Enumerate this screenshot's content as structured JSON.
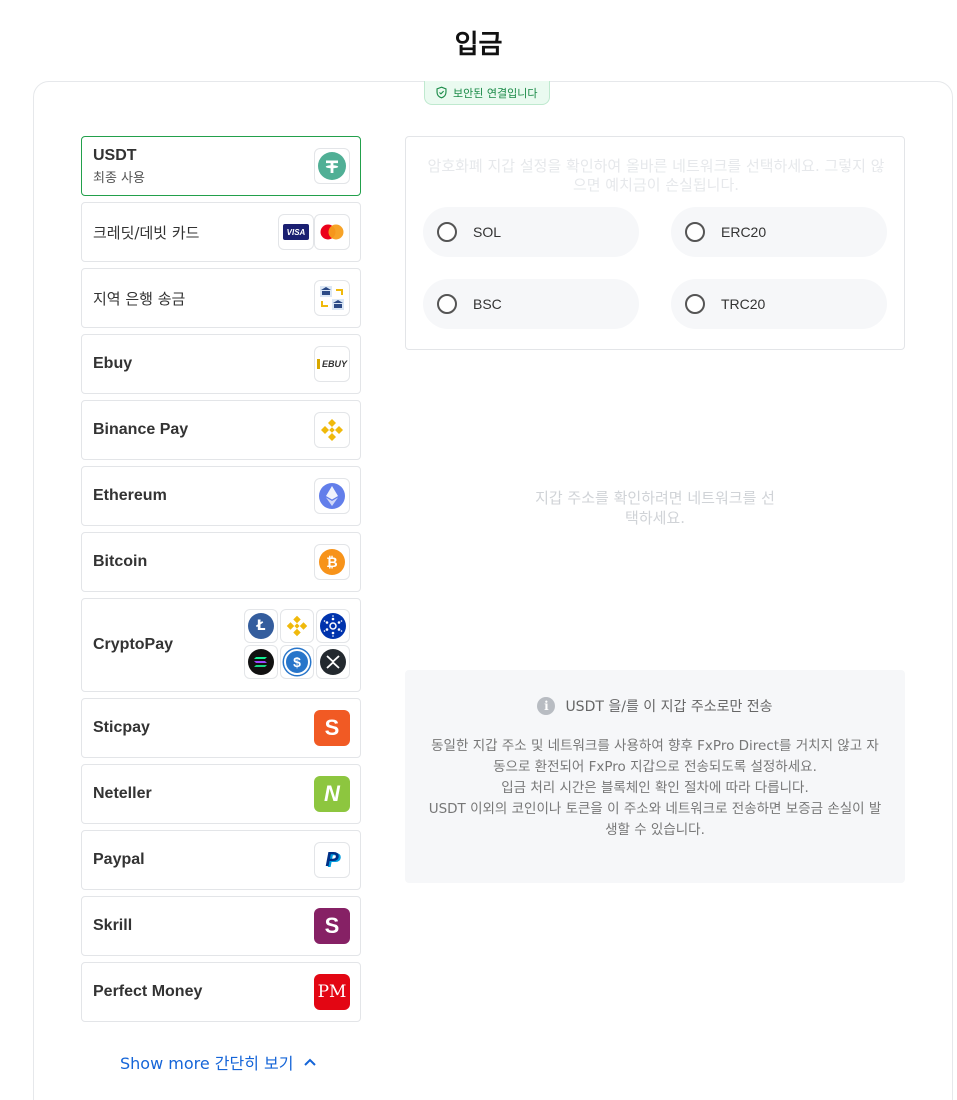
{
  "page": {
    "title": "입금"
  },
  "secure_badge": {
    "text": "보안된 연결입니다",
    "icon": "shield-check-icon",
    "color": "#1a8a47"
  },
  "methods": [
    {
      "id": "usdt",
      "label": "USDT",
      "sub": "최종 사용",
      "selected": true,
      "icons": [
        "tether-icon"
      ]
    },
    {
      "id": "card",
      "label": "크레딧/데빗 카드",
      "icons": [
        "visa-icon",
        "mastercard-icon"
      ]
    },
    {
      "id": "bank",
      "label": "지역 은행 송금",
      "icons": [
        "bank-transfer-icon"
      ]
    },
    {
      "id": "ebuy",
      "label": "Ebuy",
      "icons": [
        "ebuy-icon"
      ],
      "icon_text": "EBUY"
    },
    {
      "id": "binance",
      "label": "Binance Pay",
      "icons": [
        "binance-icon"
      ]
    },
    {
      "id": "ethereum",
      "label": "Ethereum",
      "icons": [
        "ethereum-icon"
      ]
    },
    {
      "id": "bitcoin",
      "label": "Bitcoin",
      "icons": [
        "bitcoin-icon"
      ]
    },
    {
      "id": "cryptopay",
      "label": "CryptoPay",
      "icons": [
        "litecoin-icon",
        "binance-icon",
        "cardano-icon",
        "solana-icon",
        "usdc-icon",
        "xrp-icon"
      ]
    },
    {
      "id": "sticpay",
      "label": "Sticpay",
      "icons": [
        "sticpay-icon"
      ]
    },
    {
      "id": "neteller",
      "label": "Neteller",
      "icons": [
        "neteller-icon"
      ]
    },
    {
      "id": "paypal",
      "label": "Paypal",
      "icons": [
        "paypal-icon"
      ]
    },
    {
      "id": "skrill",
      "label": "Skrill",
      "icons": [
        "skrill-icon"
      ]
    },
    {
      "id": "perfectmoney",
      "label": "Perfect Money",
      "icons": [
        "perfect-money-icon"
      ],
      "icon_text": "PM"
    }
  ],
  "icon_glyphs": {
    "visa": "VISA",
    "litecoin": "Ł",
    "bitcoin": "₿",
    "usdc": "$",
    "sticpay": "S",
    "neteller": "N",
    "paypal": "P",
    "skrill": "S"
  },
  "show_more": {
    "label": "Show more 간단히 보기",
    "icon": "chevron-up-icon"
  },
  "network": {
    "warning": "암호화폐 지갑 설정을 확인하여 올바른 네트워크를 선택하세요. 그렇지 않으면 예치금이 손실됩니다.",
    "options": [
      "SOL",
      "ERC20",
      "BSC",
      "TRC20"
    ]
  },
  "address_hint": "지갑 주소를 확인하려면 네트워크를 선택하세요.",
  "info": {
    "icon": "info-icon",
    "icon_glyph": "i",
    "title": "USDT 을/를 이 지갑 주소로만 전송",
    "lines": [
      "동일한 지갑 주소 및 네트워크를 사용하여 향후 FxPro Direct를 거치지 않고 자동으로 환전되어 FxPro 지갑으로 전송되도록 설정하세요.",
      "입금 처리 시간은 블록체인 확인 절차에 따라 다릅니다.",
      "USDT 이외의 코인이나 토큰을 이 주소와 네트워크로 전송하면 보증금 손실이 발생할 수 있습니다."
    ]
  },
  "colors": {
    "accent_green": "#22a04b",
    "link_blue": "#1565d8",
    "tether": "#50af95",
    "binance": "#f0b90b",
    "ethereum": "#627eea",
    "bitcoin": "#f7931a",
    "sticpay": "#f15a24",
    "neteller": "#8dc63f",
    "skrill": "#862165",
    "perfect_money": "#e30613"
  }
}
